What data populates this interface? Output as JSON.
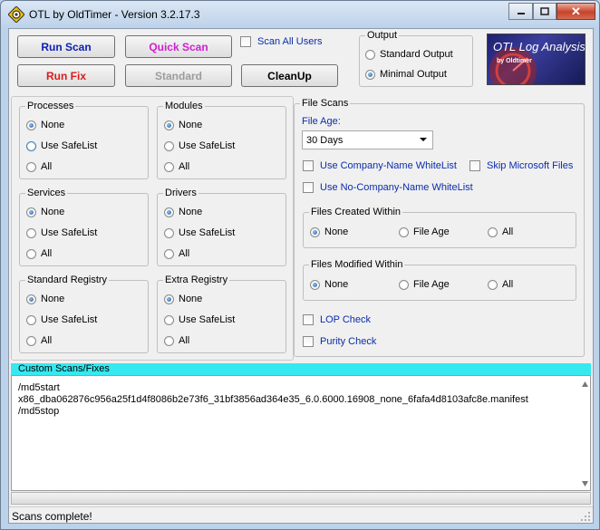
{
  "window": {
    "title": "OTL by OldTimer - Version 3.2.17.3"
  },
  "toolbar": {
    "run_scan": "Run Scan",
    "quick_scan": "Quick Scan",
    "run_fix": "Run Fix",
    "standard": "Standard",
    "cleanup": "CleanUp",
    "scan_all_users": "Scan All Users"
  },
  "output": {
    "label": "Output",
    "options": [
      "Standard Output",
      "Minimal Output"
    ],
    "selected": "Minimal Output"
  },
  "logo": {
    "title": "OTL Log Analysis",
    "subtitle": "by Oldtimer"
  },
  "groups": {
    "processes": {
      "label": "Processes",
      "options": [
        "None",
        "Use SafeList",
        "All"
      ],
      "selected": "None"
    },
    "modules": {
      "label": "Modules",
      "options": [
        "None",
        "Use SafeList",
        "All"
      ],
      "selected": "None"
    },
    "services": {
      "label": "Services",
      "options": [
        "None",
        "Use SafeList",
        "All"
      ],
      "selected": "None"
    },
    "drivers": {
      "label": "Drivers",
      "options": [
        "None",
        "Use SafeList",
        "All"
      ],
      "selected": "None"
    },
    "standard_registry": {
      "label": "Standard Registry",
      "options": [
        "None",
        "Use SafeList",
        "All"
      ],
      "selected": "None"
    },
    "extra_registry": {
      "label": "Extra Registry",
      "options": [
        "None",
        "Use SafeList",
        "All"
      ],
      "selected": "None"
    }
  },
  "file_scans": {
    "label": "File Scans",
    "file_age_label": "File Age:",
    "file_age_value": "30 Days",
    "use_company_whitelist": "Use Company-Name WhiteList",
    "skip_microsoft": "Skip Microsoft Files",
    "use_nocompany_whitelist": "Use No-Company-Name WhiteList",
    "created_within": {
      "label": "Files Created Within",
      "options": [
        "None",
        "File Age",
        "All"
      ],
      "selected": "None"
    },
    "modified_within": {
      "label": "Files Modified Within",
      "options": [
        "None",
        "File Age",
        "All"
      ],
      "selected": "None"
    },
    "lop_check": "LOP Check",
    "purity_check": "Purity Check"
  },
  "custom_scans": {
    "label": "Custom Scans/Fixes",
    "lines": [
      "/md5start",
      "x86_dba062876c956a25f1d4f8086b2e73f6_31bf3856ad364e35_6.0.6000.16908_none_6fafa4d8103afc8e.manifest",
      "/md5stop"
    ]
  },
  "status": {
    "text": "Scans complete!"
  },
  "colors": {
    "run_scan": "#0b1fb0",
    "quick_scan": "#d01fd0",
    "run_fix": "#d81c1c",
    "custom_header": "#36e8ef",
    "link_blue": "#0b2dab"
  }
}
